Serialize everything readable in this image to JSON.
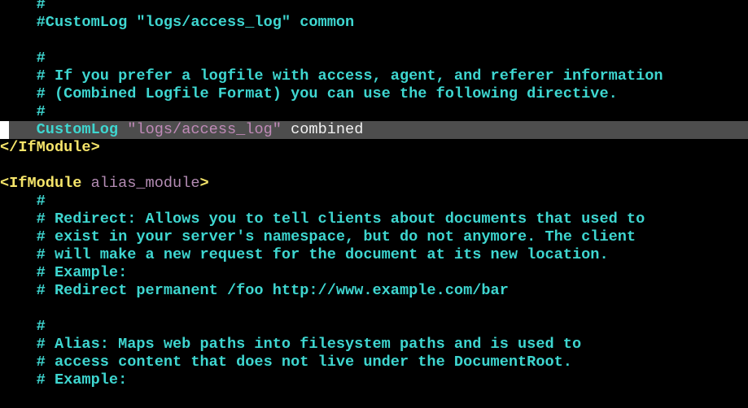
{
  "editor": {
    "file_type": "apache-config",
    "colors": {
      "background": "#000000",
      "comment": "#3ed6d0",
      "directive": "#3ed6d0",
      "string": "#c08ab8",
      "plain": "#f2f2f2",
      "tag": "#f5e46a",
      "tag_attribute": "#b48cb4",
      "cursor_line_highlight": "#4d4d4d",
      "cursor": "#ffffff"
    },
    "lines": [
      {
        "indent": "    ",
        "segments": [
          {
            "type": "comment",
            "text": "#"
          }
        ]
      },
      {
        "indent": "    ",
        "segments": [
          {
            "type": "comment",
            "text": "#CustomLog \"logs/access_log\" common"
          }
        ]
      },
      {
        "indent": "",
        "segments": []
      },
      {
        "indent": "    ",
        "segments": [
          {
            "type": "comment",
            "text": "#"
          }
        ]
      },
      {
        "indent": "    ",
        "segments": [
          {
            "type": "comment",
            "text": "# If you prefer a logfile with access, agent, and referer information"
          }
        ]
      },
      {
        "indent": "    ",
        "segments": [
          {
            "type": "comment",
            "text": "# (Combined Logfile Format) you can use the following directive."
          }
        ]
      },
      {
        "indent": "    ",
        "segments": [
          {
            "type": "comment",
            "text": "#"
          }
        ]
      },
      {
        "indent": "    ",
        "highlighted": true,
        "segments": [
          {
            "type": "keyword",
            "text": "CustomLog"
          },
          {
            "type": "plain",
            "text": " "
          },
          {
            "type": "string",
            "text": "\"logs/access_log\""
          },
          {
            "type": "plain",
            "text": " combined"
          }
        ]
      },
      {
        "indent": "",
        "segments": [
          {
            "type": "tag",
            "text": "</IfModule>"
          }
        ]
      },
      {
        "indent": "",
        "segments": []
      },
      {
        "indent": "",
        "segments": [
          {
            "type": "tag",
            "text": "<IfModule"
          },
          {
            "type": "plain",
            "text": " "
          },
          {
            "type": "attr",
            "text": "alias_module"
          },
          {
            "type": "tag",
            "text": ">"
          }
        ]
      },
      {
        "indent": "    ",
        "segments": [
          {
            "type": "comment",
            "text": "#"
          }
        ]
      },
      {
        "indent": "    ",
        "segments": [
          {
            "type": "comment",
            "text": "# Redirect: Allows you to tell clients about documents that used to"
          }
        ]
      },
      {
        "indent": "    ",
        "segments": [
          {
            "type": "comment",
            "text": "# exist in your server's namespace, but do not anymore. The client"
          }
        ]
      },
      {
        "indent": "    ",
        "segments": [
          {
            "type": "comment",
            "text": "# will make a new request for the document at its new location."
          }
        ]
      },
      {
        "indent": "    ",
        "segments": [
          {
            "type": "comment",
            "text": "# Example:"
          }
        ]
      },
      {
        "indent": "    ",
        "segments": [
          {
            "type": "comment",
            "text": "# Redirect permanent /foo http://www.example.com/bar"
          }
        ]
      },
      {
        "indent": "",
        "segments": []
      },
      {
        "indent": "    ",
        "segments": [
          {
            "type": "comment",
            "text": "#"
          }
        ]
      },
      {
        "indent": "    ",
        "segments": [
          {
            "type": "comment",
            "text": "# Alias: Maps web paths into filesystem paths and is used to"
          }
        ]
      },
      {
        "indent": "    ",
        "segments": [
          {
            "type": "comment",
            "text": "# access content that does not live under the DocumentRoot."
          }
        ]
      },
      {
        "indent": "    ",
        "segments": [
          {
            "type": "comment",
            "text": "# Example:"
          }
        ]
      }
    ]
  }
}
